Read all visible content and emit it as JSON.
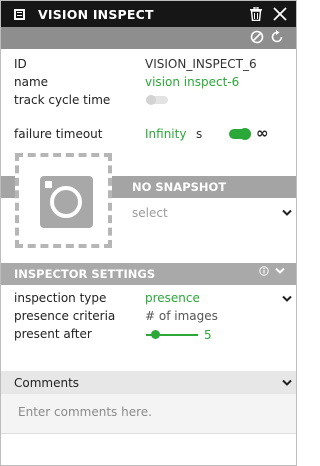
{
  "header": {
    "title": "VISION INSPECT",
    "icon": "node-icon",
    "actions": [
      "trash-icon",
      "close-icon"
    ]
  },
  "toolstrip": {
    "tools": [
      "disable-icon",
      "reset-icon"
    ]
  },
  "fields": {
    "id_label": "ID",
    "id_value": "VISION_INSPECT_6",
    "name_label": "name",
    "name_value": "vision inspect-6",
    "track_label": "track cycle time",
    "failure_label": "failure timeout",
    "failure_value": "Infinity",
    "failure_unit": "s",
    "infinity_symbol": "∞"
  },
  "snapshot": {
    "header": "NO SNAPSHOT",
    "select_placeholder": "select"
  },
  "inspector": {
    "title": "INSPECTOR SETTINGS",
    "inspection_type_label": "inspection type",
    "inspection_type_value": "presence",
    "presence_criteria_label": "presence criteria",
    "presence_criteria_value": "# of images",
    "present_after_label": "present after",
    "present_after_value": "5"
  },
  "comments": {
    "title": "Comments",
    "placeholder": "Enter comments here."
  },
  "colors": {
    "accent": "#2aa838",
    "titlebar": "#161616",
    "section": "#a9a9a9"
  }
}
